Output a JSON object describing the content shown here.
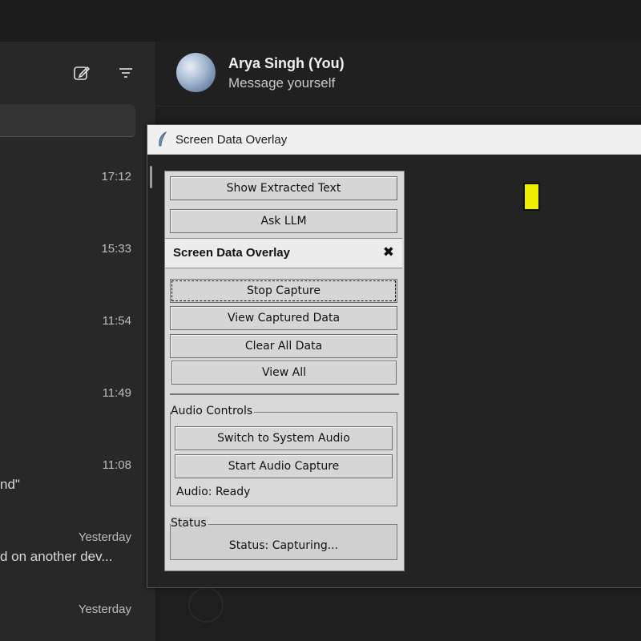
{
  "header": {
    "contact_name": "Arya Singh (You)",
    "contact_subtitle": "Message yourself"
  },
  "sidebar": {
    "icons": [
      "new-chat-icon",
      "filter-icon"
    ],
    "chats": [
      {
        "time": "17:12",
        "preview": ""
      },
      {
        "time": "15:33",
        "preview": ""
      },
      {
        "time": "11:54",
        "preview": ""
      },
      {
        "time": "11:49",
        "preview": ""
      },
      {
        "time": "11:08",
        "preview": "nd\""
      },
      {
        "time": "Yesterday",
        "preview": "d on another dev..."
      },
      {
        "time": "Yesterday",
        "preview": ""
      }
    ]
  },
  "overlay_window": {
    "title": "Screen Data Overlay",
    "panel": {
      "buttons_top": [
        "Show Extracted Text",
        "Ask LLM"
      ],
      "drag_title": "Screen Data Overlay",
      "close_glyph": "✖",
      "buttons_main": [
        "Stop Capture",
        "View Captured Data",
        "Clear All Data",
        "View All"
      ],
      "audio_group": {
        "label": "Audio Controls",
        "buttons": [
          "Switch to System Audio",
          "Start Audio Capture"
        ],
        "status": "Audio: Ready"
      },
      "status_group": {
        "label": "Status",
        "text": "Status: Capturing..."
      }
    }
  },
  "colors": {
    "marker": "#eeee00",
    "panel_bg": "#d9d9d9",
    "app_bg": "#202020"
  }
}
